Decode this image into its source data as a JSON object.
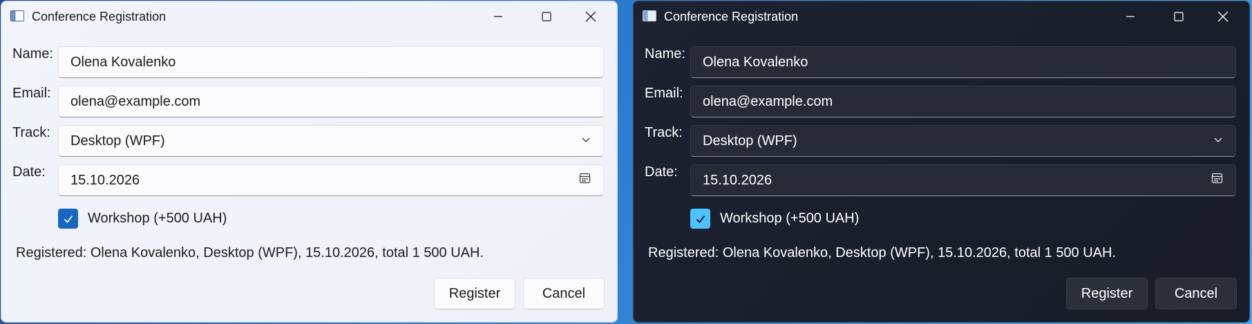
{
  "window": {
    "title": "Conference Registration"
  },
  "form": {
    "name_label": "Name:",
    "name_value": "Olena Kovalenko",
    "email_label": "Email:",
    "email_value": "olena@example.com",
    "track_label": "Track:",
    "track_value": "Desktop (WPF)",
    "date_label": "Date:",
    "date_value": "15.10.2026",
    "workshop_label": "Workshop (+500 UAH)",
    "workshop_checked": true
  },
  "status_text": "Registered: Olena Kovalenko, Desktop (WPF), 15.10.2026, total 1 500 UAH.",
  "buttons": {
    "register": "Register",
    "cancel": "Cancel"
  },
  "icons": {
    "app": "app-window-icon",
    "minimize": "minimize-icon",
    "maximize": "maximize-icon",
    "close": "close-icon",
    "dropdown": "chevron-down-icon",
    "calendar": "calendar-icon",
    "check": "checkmark-icon"
  },
  "themes": {
    "light": {
      "accent": "#1966c2",
      "background": "#f1f4fa"
    },
    "dark": {
      "accent": "#4cc2ff",
      "background": "#1c2230"
    }
  }
}
